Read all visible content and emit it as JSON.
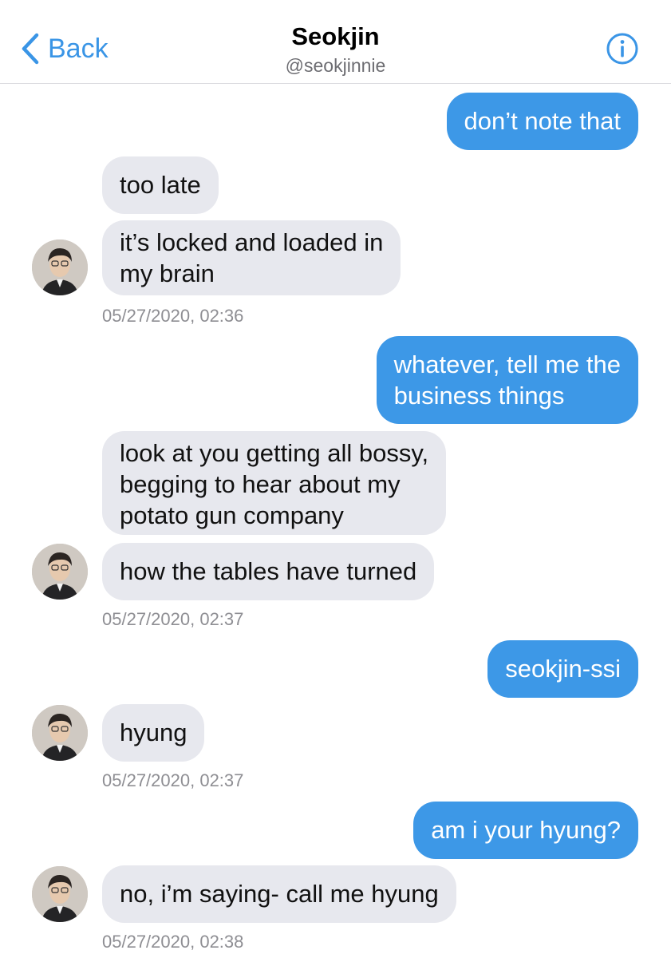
{
  "header": {
    "back_label": "Back",
    "name": "Seokjin",
    "handle": "@seokjinnie"
  },
  "colors": {
    "accent": "#3a95e6",
    "outgoing_bubble": "#3d98e7",
    "incoming_bubble": "#e7e8ee",
    "timestamp": "#8e8e93"
  },
  "messages": [
    {
      "from": "me",
      "text": "don’t note that"
    },
    {
      "from": "them",
      "text": "too late"
    },
    {
      "from": "them",
      "lines": [
        "it’s locked and loaded in",
        "my brain"
      ]
    },
    {
      "timestamp": "05/27/2020, 02:36"
    },
    {
      "from": "me",
      "lines": [
        "whatever, tell me the",
        "business things"
      ]
    },
    {
      "from": "them",
      "lines": [
        "look at you getting all bossy,",
        "begging to hear about my",
        "potato gun company"
      ]
    },
    {
      "from": "them",
      "text": "how the tables have turned"
    },
    {
      "timestamp": "05/27/2020, 02:37"
    },
    {
      "from": "me",
      "text": "seokjin-ssi"
    },
    {
      "from": "them",
      "text": "hyung"
    },
    {
      "timestamp": "05/27/2020, 02:37"
    },
    {
      "from": "me",
      "text": "am i your hyung?"
    },
    {
      "from": "them",
      "text": "no, i’m saying- call me hyung"
    },
    {
      "timestamp": "05/27/2020, 02:38"
    }
  ]
}
